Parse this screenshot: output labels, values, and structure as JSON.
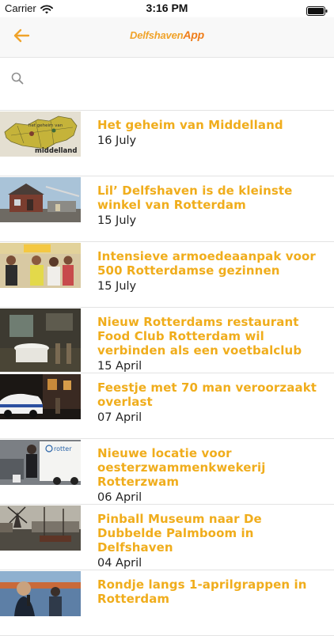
{
  "status_bar": {
    "carrier": "Carrier",
    "time": "3:16 PM"
  },
  "nav": {
    "logo_main": "Delfshaven",
    "logo_app": "App",
    "back_icon": "arrow-left-icon",
    "accent_color": "#f0a32a"
  },
  "search": {
    "icon": "search-icon",
    "placeholder": "",
    "value": ""
  },
  "news": [
    {
      "title": "Het geheim van Middelland",
      "date": "16 July",
      "thumb_caption_top": "het geheim van",
      "thumb_caption_bottom": "middelland"
    },
    {
      "title": "Lil’ Delfshaven is de kleinste winkel van Rotterdam",
      "date": "15 July"
    },
    {
      "title": "Intensieve armoedeaanpak voor 500 Rotterdamse gezinnen",
      "date": "15 July"
    },
    {
      "title": "Nieuw Rotterdams restaurant Food Club Rotterdam wil verbinden als een voetbalclub",
      "date": "15 April"
    },
    {
      "title": "Feestje met 70 man veroorzaakt overlast",
      "date": "07 April"
    },
    {
      "title": "Nieuwe locatie voor oesterzwammenkwekerij Rotterzwam",
      "date": "06 April",
      "thumb_caption_top": "rotter"
    },
    {
      "title": "Pinball Museum naar De Dubbelde Palmboom in Delfshaven",
      "date": "04 April"
    },
    {
      "title": "Rondje langs 1-aprilgrappen in Rotterdam",
      "date": ""
    }
  ]
}
